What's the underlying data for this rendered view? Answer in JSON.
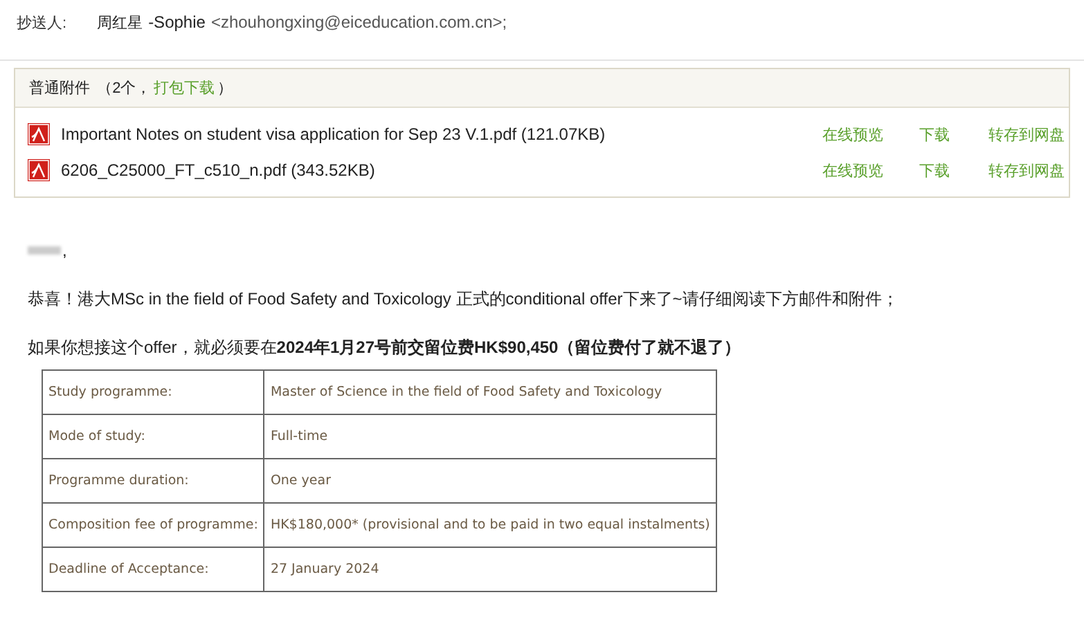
{
  "cc": {
    "label": "抄送人:",
    "name": "周红星",
    "rest": "-Sophie",
    "email": "<zhouhongxing@eiceducation.com.cn>;"
  },
  "attachments": {
    "title": "普通附件",
    "count_open": "（2个，",
    "bundle_link": "打包下载",
    "count_close": "）",
    "files": [
      {
        "name": "Important Notes on student visa application for Sep 23 V.1.pdf (121.07KB)",
        "actions": [
          "在线预览",
          "下载",
          "转存到网盘"
        ]
      },
      {
        "name": "6206_C25000_FT_c510_n.pdf (343.52KB)",
        "actions": [
          "在线预览",
          "下载",
          "转存到网盘"
        ]
      }
    ]
  },
  "body": {
    "greeting": ",",
    "paragraphs": [
      "恭喜！港大MSc in the field of Food Safety and Toxicology 正式的conditional offer下来了~请仔细阅读下方邮件和附件；",
      "如果你想接这个offer，就必须要在**2024年1月27号前交留位费HK$90,450（留位费付了就不退了）**"
    ],
    "table": [
      [
        "Study programme:",
        "Master of Science in the field of Food Safety and Toxicology"
      ],
      [
        "Mode of study:",
        "Full-time"
      ],
      [
        "Programme duration:",
        "One year"
      ],
      [
        "Composition fee of programme:",
        "HK$180,000* (provisional and to be paid in two equal instalments)"
      ],
      [
        "Deadline of Acceptance:",
        "27 January 2024"
      ]
    ]
  }
}
